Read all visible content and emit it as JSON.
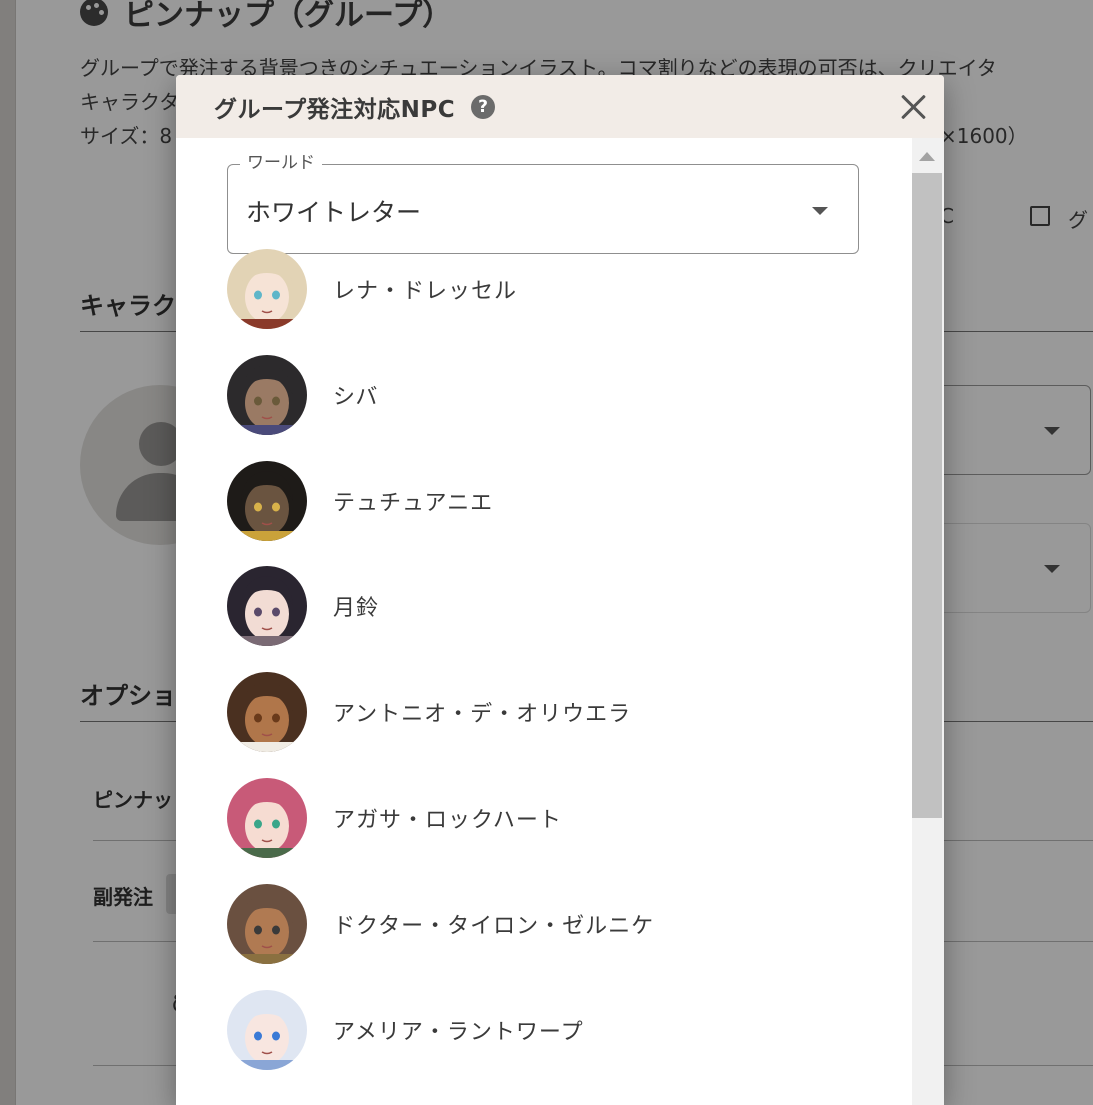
{
  "background": {
    "title": "ピンナップ（グループ）",
    "desc_line1": "グループで発注する背景つきのシチュエーションイラスト。コマ割りなどの表現の可否は、クリエイタ",
    "desc_line2": "キャラクタ",
    "desc_line3": "サイズ：8",
    "desc_size_tail": "×1600）",
    "link_fragment": "C",
    "link_text": "グ",
    "section_character": "キャラクタ",
    "section_option": "オプション",
    "row_pinup": "ピンナッ",
    "row_sub_order": "副発注",
    "row_dot": "δ"
  },
  "modal": {
    "title": "グループ発注対応NPC",
    "help_icon": "?",
    "close_icon": "close-icon",
    "world_select": {
      "label": "ワールド",
      "value": "ホワイトレター"
    },
    "npcs": [
      {
        "name": "レナ・ドレッセル",
        "hair": "#e2d3b5",
        "skin": "#f6e3d6",
        "accent": "#8a3a2a",
        "eye": "#5fb6c9"
      },
      {
        "name": "シバ",
        "hair": "#2c2a2c",
        "skin": "#9a7a64",
        "accent": "#4a4a7a",
        "eye": "#6a5a3a"
      },
      {
        "name": "テュチュアニエ",
        "hair": "#1e1b18",
        "skin": "#6a5440",
        "accent": "#caa23a",
        "eye": "#d8b24a"
      },
      {
        "name": "月鈴",
        "hair": "#2a2530",
        "skin": "#f2dcd4",
        "accent": "#7a6a74",
        "eye": "#5a4a6a"
      },
      {
        "name": "アントニオ・デ・オリウエラ",
        "hair": "#4a3020",
        "skin": "#b0764a",
        "accent": "#f0ece4",
        "eye": "#6a3a1a"
      },
      {
        "name": "アガサ・ロックハート",
        "hair": "#c85a78",
        "skin": "#f6dcd2",
        "accent": "#4a6a4a",
        "eye": "#3aa68a"
      },
      {
        "name": "ドクター・タイロン・ゼルニケ",
        "hair": "#6a5040",
        "skin": "#b07a52",
        "accent": "#8a7040",
        "eye": "#3a3a3a"
      },
      {
        "name": "アメリア・ラントワープ",
        "hair": "#dfe6f2",
        "skin": "#f8e6e0",
        "accent": "#8aa6d6",
        "eye": "#3a7ad6"
      }
    ]
  }
}
